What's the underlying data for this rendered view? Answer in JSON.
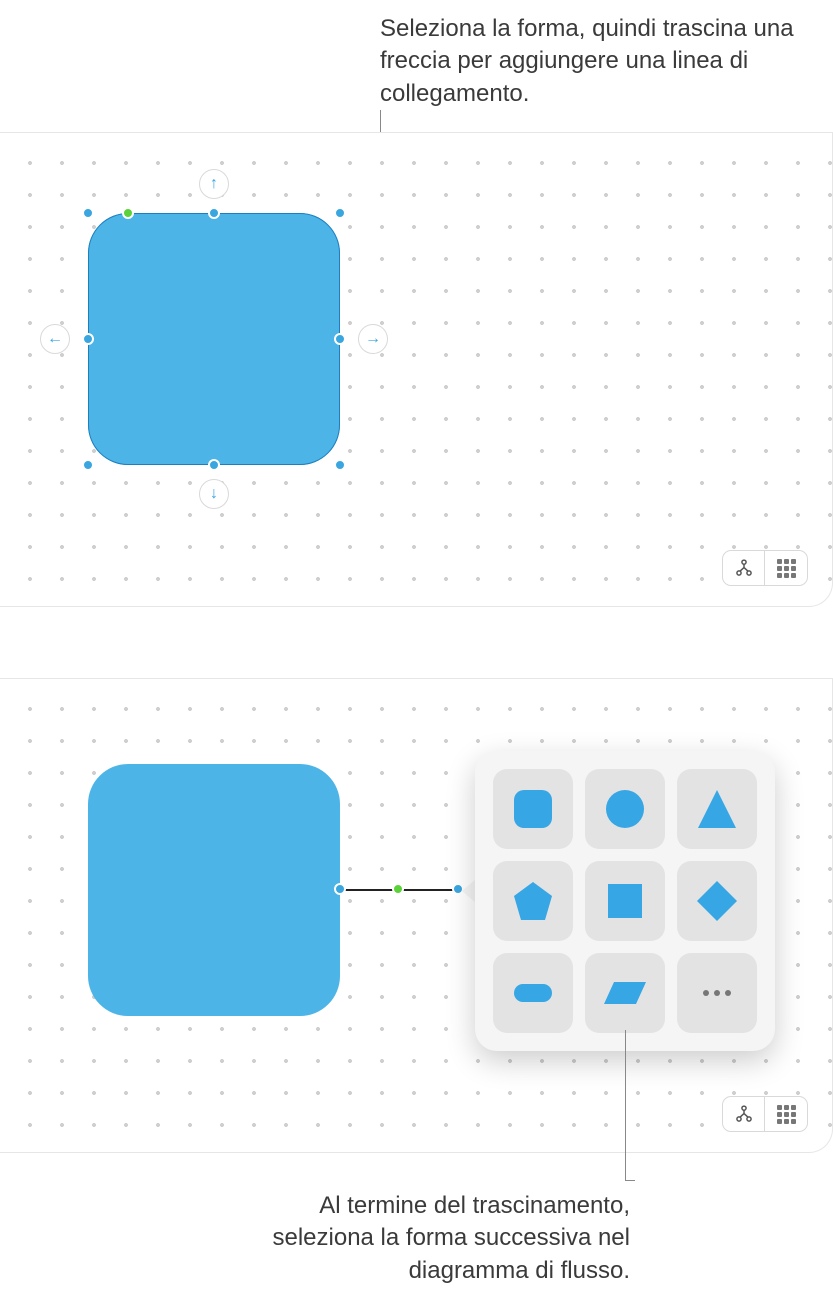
{
  "callouts": {
    "top": "Seleziona la forma, quindi trascina una freccia per aggiungere una linea di collegamento.",
    "bottom": "Al termine del trascinamento, seleziona la forma successiva nel diagramma di flusso."
  },
  "canvas1": {
    "shape": {
      "type": "rounded-rectangle",
      "color": "#4cb4e7",
      "selected": true
    },
    "direction_arrows": [
      "up",
      "down",
      "left",
      "right"
    ],
    "toolbar": {
      "items": [
        "diagram-mode",
        "grid-toggle"
      ]
    }
  },
  "canvas2": {
    "shape": {
      "type": "rounded-rectangle",
      "color": "#4cb4e7",
      "selected": false
    },
    "connection": {
      "has_midpoint": true
    },
    "shape_picker": {
      "shapes": [
        "rounded-square",
        "circle",
        "triangle",
        "pentagon",
        "square",
        "diamond",
        "capsule",
        "parallelogram",
        "more"
      ]
    },
    "toolbar": {
      "items": [
        "diagram-mode",
        "grid-toggle"
      ]
    }
  },
  "colors": {
    "shape_fill": "#4cb4e7",
    "handle": "#3aa6e0",
    "midpoint": "#5cd23a"
  }
}
